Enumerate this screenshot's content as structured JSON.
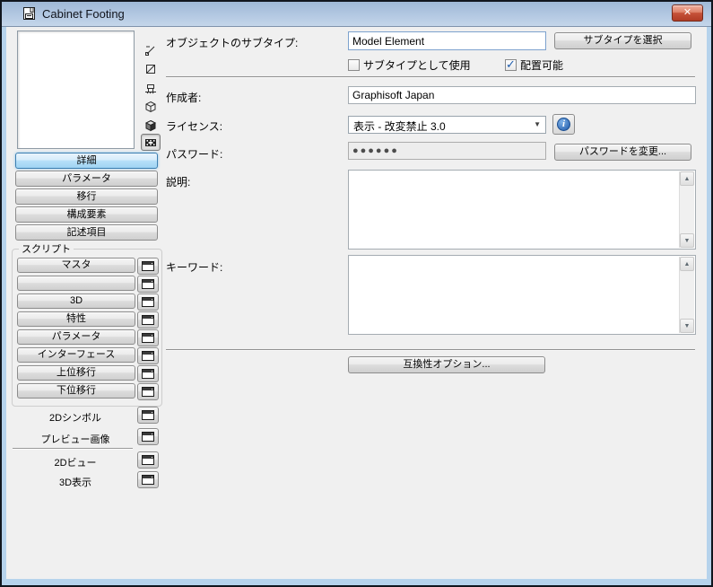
{
  "window": {
    "title": "Cabinet Footing"
  },
  "icons": {
    "close": "✕",
    "dropdown_arrow": "▼",
    "scroll_up": "▲",
    "scroll_down": "▼",
    "info": "i",
    "preview_modes": [
      "symbol-line",
      "hatched-square",
      "front-view",
      "wireframe-cube",
      "shaded-cube",
      "filmstrip"
    ]
  },
  "sidebar": {
    "nav": [
      {
        "label": "詳細",
        "active": true
      },
      {
        "label": "パラメータ",
        "active": false
      },
      {
        "label": "移行",
        "active": false
      },
      {
        "label": "構成要素",
        "active": false
      },
      {
        "label": "記述項目",
        "active": false
      }
    ],
    "script_group": {
      "title": "スクリプト",
      "scripts": [
        {
          "label": "マスタ"
        },
        {
          "label": ""
        },
        {
          "label": "3D"
        },
        {
          "label": "特性"
        },
        {
          "label": "パラメータ"
        },
        {
          "label": "インターフェース"
        },
        {
          "label": "上位移行"
        },
        {
          "label": "下位移行"
        }
      ]
    },
    "views": [
      {
        "label": "2Dシンボル"
      },
      {
        "label": "プレビュー画像"
      },
      {
        "label": "2Dビュー"
      },
      {
        "label": "3D表示"
      }
    ]
  },
  "main": {
    "subtype_label": "オブジェクトのサブタイプ:",
    "subtype_value": "Model Element",
    "subtype_select_button": "サブタイプを選択",
    "use_as_subtype_label": "サブタイプとして使用",
    "use_as_subtype_checked": false,
    "placeable_label": "配置可能",
    "placeable_checked": true,
    "author_label": "作成者:",
    "author_value": "Graphisoft Japan",
    "license_label": "ライセンス:",
    "license_value": "表示 - 改変禁止 3.0",
    "password_label": "パスワード:",
    "password_value": "●●●●●●",
    "password_change_button": "パスワードを変更...",
    "description_label": "説明:",
    "description_value": "",
    "keywords_label": "キーワード:",
    "keywords_value": "",
    "compatibility_button": "互換性オプション..."
  }
}
